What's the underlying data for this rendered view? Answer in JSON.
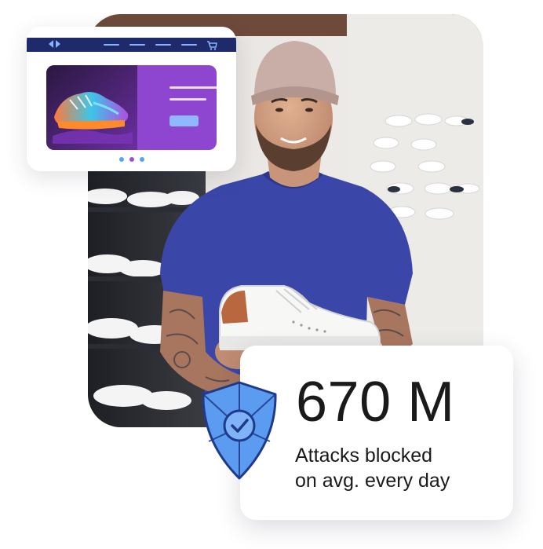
{
  "stat": {
    "value": "670 M",
    "caption_line1": "Attacks blocked",
    "caption_line2": "on avg. every day"
  },
  "icons": {
    "browser_back": "chevron-left-icon",
    "browser_forward": "chevron-right-icon",
    "cart": "shopping-cart-icon",
    "shield": "shield-check-icon"
  },
  "colors": {
    "browser_bar": "#1f2a6b",
    "accent_light_blue": "#86b4ff",
    "banner_purple": "#8e45cf",
    "shield_blue": "#5b9cf0",
    "shield_dark": "#1f3a8a",
    "shirt_blue": "#3a47a8"
  },
  "carousel": {
    "dots": 3,
    "active_index": 0
  }
}
